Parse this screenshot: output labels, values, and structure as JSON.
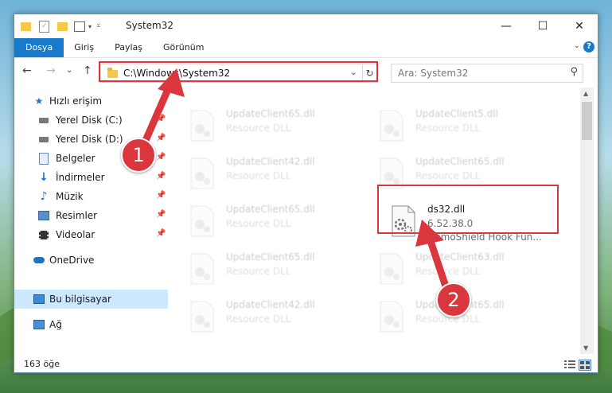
{
  "window": {
    "title": "System32",
    "minimize_glyph": "—",
    "maximize_glyph": "☐",
    "close_glyph": "✕"
  },
  "ribbon": {
    "tabs": [
      {
        "label": "Dosya",
        "active": true
      },
      {
        "label": "Giriş",
        "active": false
      },
      {
        "label": "Paylaş",
        "active": false
      },
      {
        "label": "Görünüm",
        "active": false
      }
    ],
    "help_glyph": "?"
  },
  "nav": {
    "back_glyph": "←",
    "forward_glyph": "→",
    "recent_glyph": "⌄",
    "up_glyph": "↑",
    "address": "C:\\Windows\\System32",
    "dropdown_glyph": "⌄",
    "refresh_glyph": "↻",
    "search_placeholder": "Ara: System32",
    "search_glyph": "⚲"
  },
  "sidebar": {
    "quick_access": "Hızlı erişim",
    "items": [
      {
        "label": "Yerel Disk (C:)",
        "icon": "drive-icon"
      },
      {
        "label": "Yerel Disk (D:)",
        "icon": "drive-icon"
      },
      {
        "label": "Belgeler",
        "icon": "documents-icon"
      },
      {
        "label": "İndirmeler",
        "icon": "downloads-icon"
      },
      {
        "label": "Müzik",
        "icon": "music-icon"
      },
      {
        "label": "Resimler",
        "icon": "pictures-icon"
      },
      {
        "label": "Videolar",
        "icon": "videos-icon"
      }
    ],
    "onedrive": "OneDrive",
    "this_pc": "Bu bilgisayar",
    "network": "Ağ"
  },
  "files": {
    "tiles": [
      {
        "name": "UpdateClient65.dll",
        "type": "Resource DLL",
        "faded": true
      },
      {
        "name": "UpdateClient5.dll",
        "type": "Resource DLL",
        "faded": true
      },
      {
        "name": "UpdateClient42.dll",
        "type": "Resource DLL",
        "faded": true
      },
      {
        "name": "UpdateClient65.dll",
        "type": "Resource DLL",
        "faded": true
      },
      {
        "name": "UpdateClient65.dll",
        "type": "Resource DLL",
        "faded": true
      },
      {
        "name": "ds32.dll",
        "version": "6.52.38.0",
        "description": "DemoShield Hook Fun...",
        "faded": false
      },
      {
        "name": "UpdateClient65.dll",
        "type": "Resource DLL",
        "faded": true
      },
      {
        "name": "UpdateClient63.dll",
        "type": "Resource DLL",
        "faded": true
      },
      {
        "name": "UpdateClient42.dll",
        "type": "Resource DLL",
        "faded": true
      },
      {
        "name": "UpdateClient65.dll",
        "type": "Resource DLL",
        "faded": true
      }
    ]
  },
  "status": {
    "item_count": "163 öğe"
  },
  "annotations": {
    "step1": "1",
    "step2": "2",
    "color": "#d9363e"
  }
}
